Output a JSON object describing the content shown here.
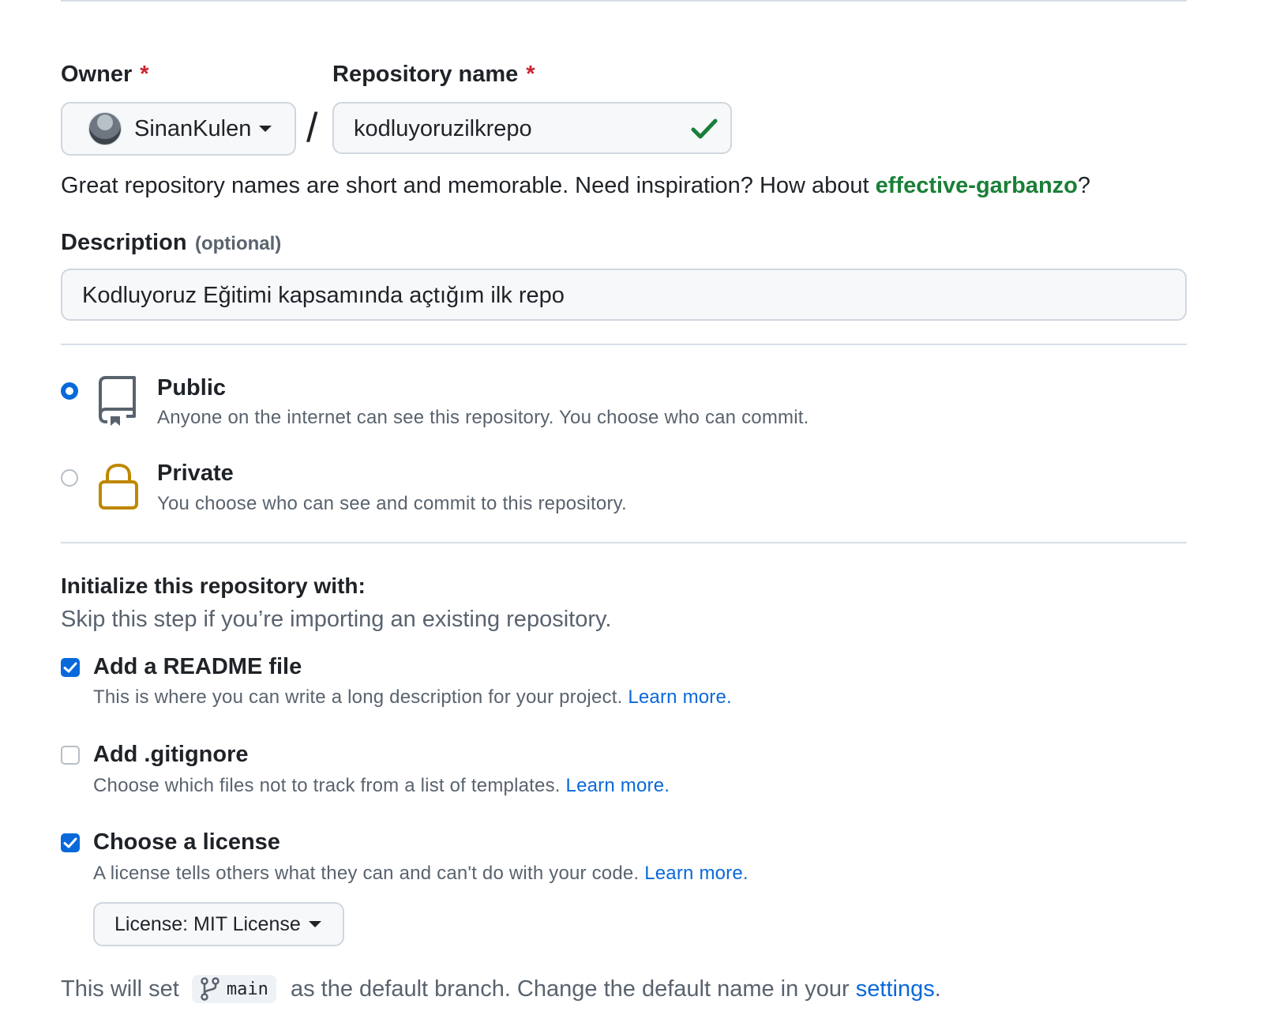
{
  "owner": {
    "label": "Owner",
    "required_mark": "*",
    "selected": "SinanKulen"
  },
  "repository": {
    "label": "Repository name",
    "required_mark": "*",
    "value": "kodluyoruzilkrepo",
    "status_icon": "check-icon",
    "separator": "/"
  },
  "name_hint": {
    "text": "Great repository names are short and memorable. Need inspiration? How about ",
    "suggestion": "effective-garbanzo",
    "suffix": "?"
  },
  "description": {
    "label": "Description",
    "optional": "(optional)",
    "value": "Kodluyoruz Eğitimi kapsamında açtığım ilk repo"
  },
  "visibility": {
    "selected": "public",
    "options": [
      {
        "title": "Public",
        "desc": "Anyone on the internet can see this repository. You choose who can commit.",
        "icon": "repo-icon"
      },
      {
        "title": "Private",
        "desc": "You choose who can see and commit to this repository.",
        "icon": "lock-icon"
      }
    ]
  },
  "init": {
    "title": "Initialize this repository with:",
    "subtitle": "Skip this step if you’re importing an existing repository.",
    "options": [
      {
        "title": "Add a README file",
        "desc": "This is where you can write a long description for your project. ",
        "link": "Learn more.",
        "checked": true
      },
      {
        "title": "Add .gitignore",
        "desc": "Choose which files not to track from a list of templates. ",
        "link": "Learn more.",
        "checked": false
      },
      {
        "title": "Choose a license",
        "desc": "A license tells others what they can and can't do with your code. ",
        "link": "Learn more.",
        "checked": true
      }
    ],
    "license_button": "License: MIT License"
  },
  "branch_note": {
    "prefix": "This will set ",
    "branch": "main",
    "middle": " as the default branch. Change the default name in your ",
    "link": "settings",
    "suffix": "."
  },
  "colors": {
    "accent": "#0969da",
    "success": "#1a7f37",
    "danger": "#cf222e",
    "lock": "#bf8700"
  }
}
